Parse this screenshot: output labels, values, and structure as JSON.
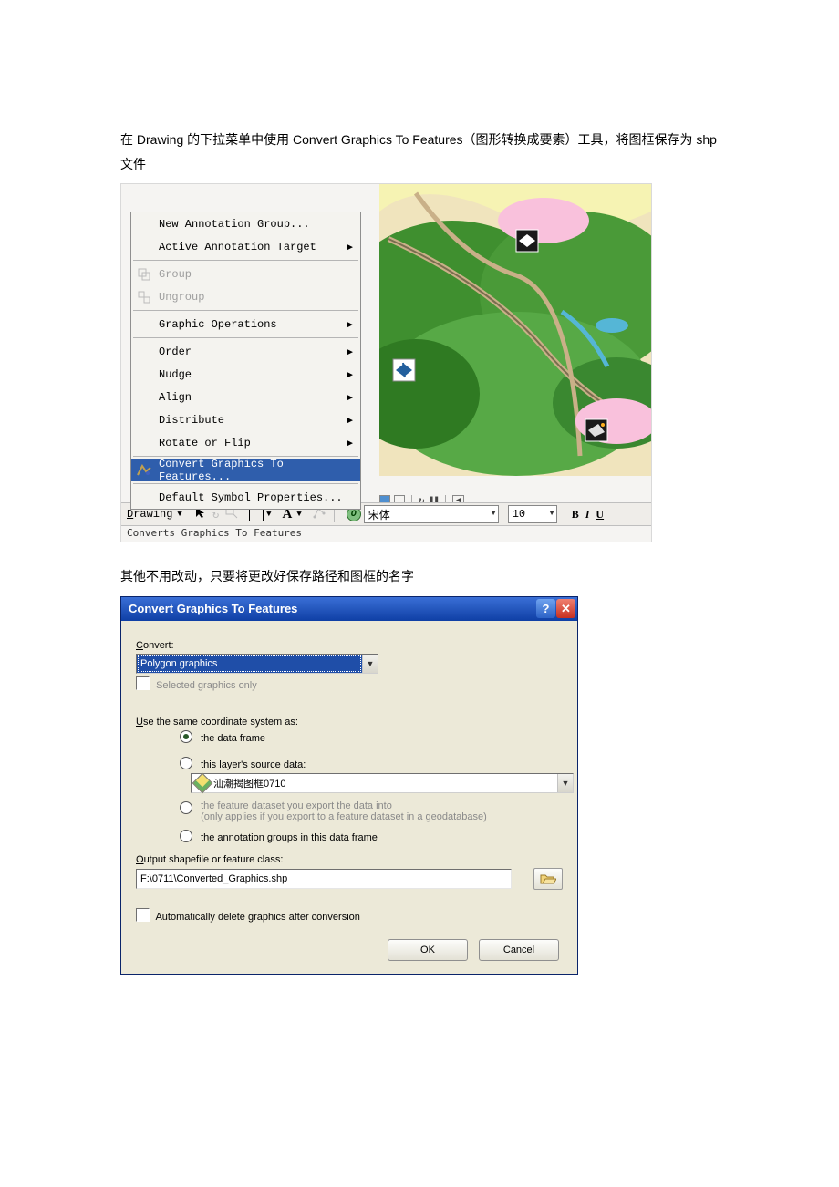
{
  "para1": "在 Drawing 的下拉菜单中使用 Convert Graphics To Features（图形转换成要素）工具，将图框保存为 shp 文件",
  "para2": "其他不用改动，只要将更改好保存路径和图框的名字",
  "menu": {
    "new_annotation_group": "New Annotation Group...",
    "active_annotation_target": "Active Annotation Target",
    "group": "Group",
    "ungroup": "Ungroup",
    "graphic_operations": "Graphic Operations",
    "order": "Order",
    "nudge": "Nudge",
    "align": "Align",
    "distribute": "Distribute",
    "rotate_or_flip": "Rotate or Flip",
    "convert_graphics": "Convert Graphics To Features...",
    "default_symbol": "Default Symbol Properties..."
  },
  "toolbar": {
    "drawing": "Drawing",
    "font_name": "宋体",
    "font_size": "10",
    "bold": "B",
    "italic": "I",
    "underline": "U",
    "a_btn": "A"
  },
  "statusbar": "Converts Graphics To Features",
  "dialog": {
    "title": "Convert Graphics To Features",
    "convert_label": "Convert:",
    "convert_value": "Polygon graphics",
    "selected_only": "Selected graphics only",
    "use_same_cs": "Use the same coordinate system as:",
    "opt_dataframe": "the data frame",
    "opt_layer": "this layer's source data:",
    "layer_value": "汕潮揭图框0710",
    "opt_feature_dataset_l1": "the feature dataset you export the data into",
    "opt_feature_dataset_l2": "(only applies if you export to a feature dataset in a geodatabase)",
    "opt_anno": "the annotation groups in this data frame",
    "output_label": "Output shapefile or feature class:",
    "output_value": "F:\\0711\\Converted_Graphics.shp",
    "auto_delete": "Automatically delete graphics after conversion",
    "ok": "OK",
    "cancel": "Cancel"
  }
}
